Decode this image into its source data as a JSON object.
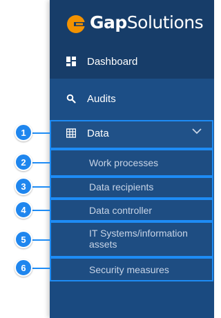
{
  "brand": {
    "name_bold": "Gap",
    "name_light": "Solutions",
    "logo_color": "#f39200"
  },
  "nav": {
    "dashboard_label": "Dashboard",
    "audits_label": "Audits",
    "data_label": "Data",
    "data_submenu": [
      "Work processes",
      "Data recipients",
      "Data controller",
      "IT Systems/information assets",
      "Security measures"
    ]
  },
  "markers": [
    "1",
    "2",
    "3",
    "4",
    "5",
    "6"
  ],
  "colors": {
    "sidebar": "#1a4a80",
    "sidebar_header": "#173d69",
    "highlight": "#1e8cf5"
  }
}
